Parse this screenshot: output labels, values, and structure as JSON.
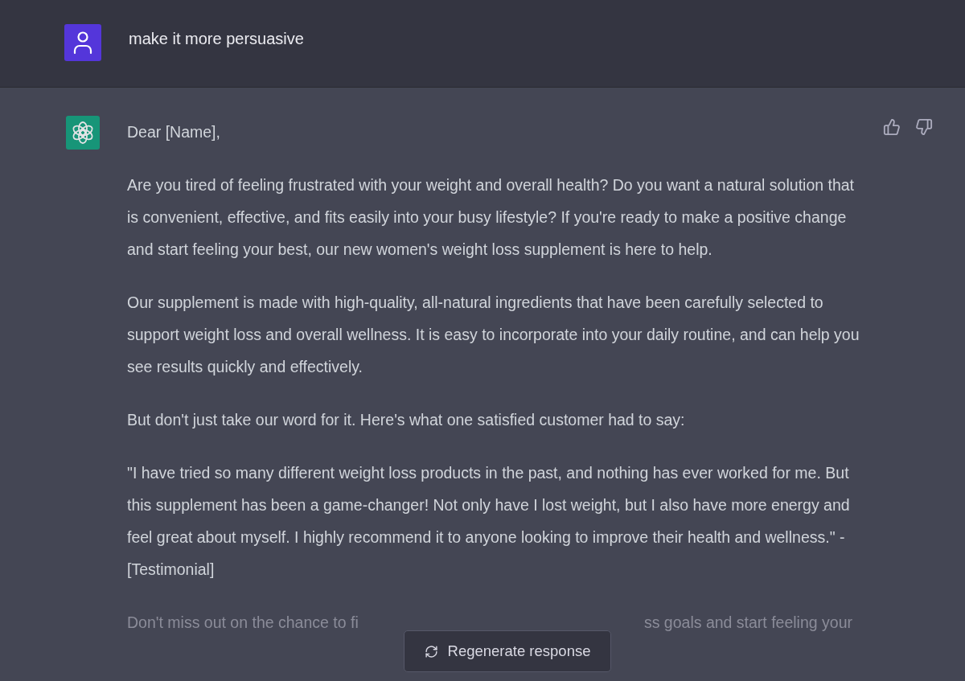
{
  "user_message": {
    "text": "make it more persuasive"
  },
  "assistant_message": {
    "paragraphs": [
      "Dear [Name],",
      "Are you tired of feeling frustrated with your weight and overall health? Do you want a natural solution that is convenient, effective, and fits easily into your busy lifestyle? If you're ready to make a positive change and start feeling your best, our new women's weight loss supplement is here to help.",
      "Our supplement is made with high-quality, all-natural ingredients that have been carefully selected to support weight loss and overall wellness. It is easy to incorporate into your daily routine, and can help you see results quickly and effectively.",
      "But don't just take our word for it. Here's what one satisfied customer had to say:",
      "\"I have tried so many different weight loss products in the past, and nothing has ever worked for me. But this supplement has been a game-changer! Not only have I lost weight, but I also have more energy and feel great about myself. I highly recommend it to anyone looking to improve their health and wellness.\" - [Testimonial]"
    ],
    "partial_paragraph": [
      "Don't miss out on the chance to fi",
      "ss goals and start feeling your"
    ]
  },
  "regenerate_button": {
    "label": "Regenerate response"
  }
}
